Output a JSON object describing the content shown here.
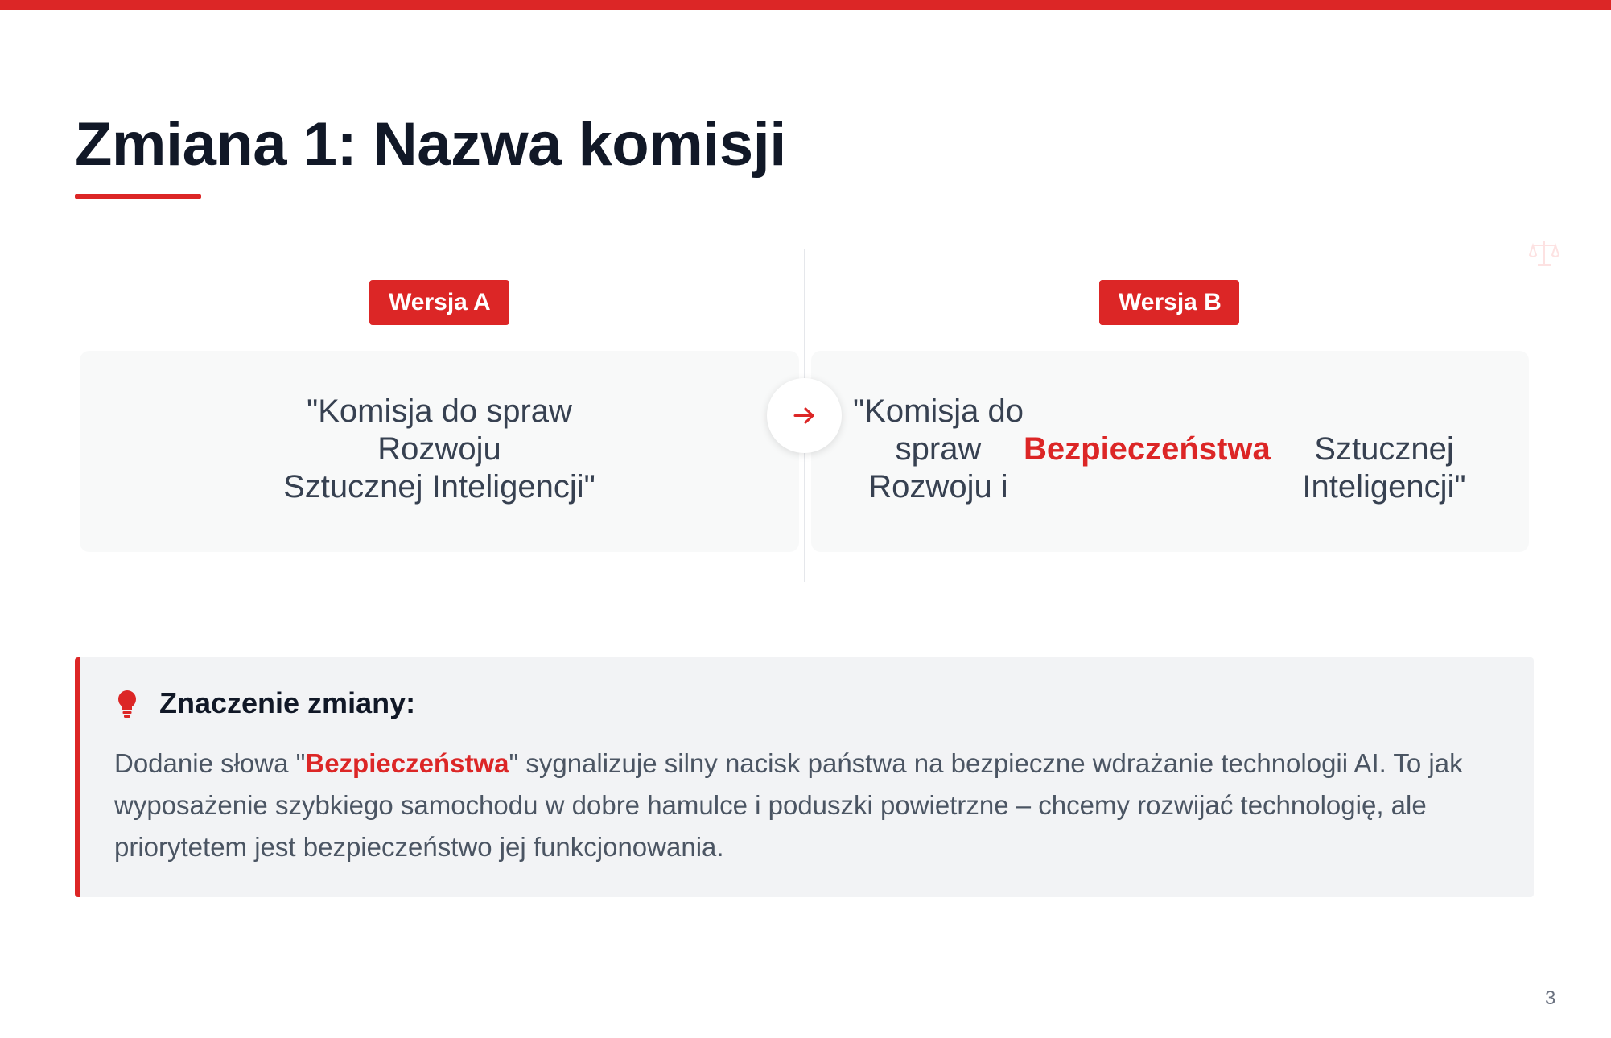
{
  "slide": {
    "title": "Zmiana 1: Nazwa komisji",
    "page_number": "3"
  },
  "version_a": {
    "badge": "Wersja A",
    "text_line1": "\"Komisja do spraw",
    "text_line2": "Rozwoju",
    "text_line3": "Sztucznej Inteligencji\""
  },
  "version_b": {
    "badge": "Wersja B",
    "text_line1": "\"Komisja do",
    "text_line2": "spraw",
    "text_line3": "Rozwoju i",
    "highlight": "Bezpieczeństwa",
    "text_after1": "Sztucznej",
    "text_after2": "Inteligencji\""
  },
  "significance": {
    "title": "Znaczenie zmiany:",
    "text_before": "Dodanie słowa \"",
    "highlight": "Bezpieczeństwa",
    "text_after": "\" sygnalizuje silny nacisk państwa na bezpieczne wdrażanie technologii AI. To jak wyposażenie szybkiego samochodu w dobre hamulce i poduszki powietrzne – chcemy rozwijać technologię, ale priorytetem jest bezpieczeństwo jej funkcjonowania."
  },
  "icons": {
    "arrow": "arrow-right-icon",
    "bulb": "lightbulb-icon",
    "scale": "balance-scale-icon"
  },
  "colors": {
    "accent": "#dc2626",
    "title": "#111827",
    "body_text": "#4b5563",
    "card_bg": "#f8f9f9",
    "info_bg": "#f2f3f5"
  }
}
